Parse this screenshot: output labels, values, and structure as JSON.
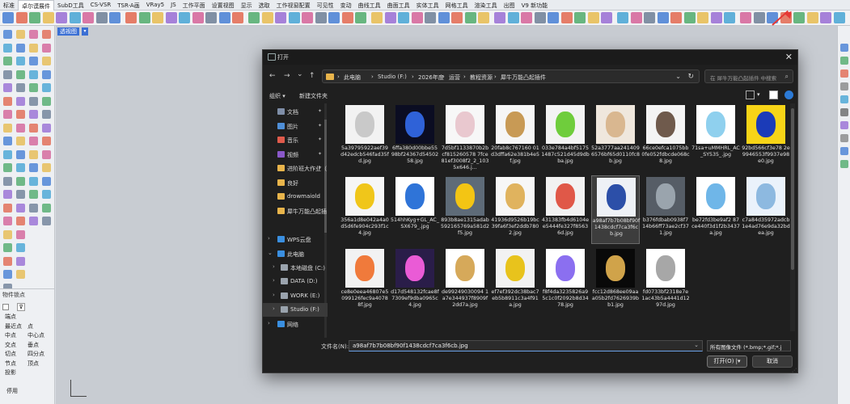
{
  "menu_tabs": [
    "标准",
    "卓尔谟展件",
    "SubD工具",
    "CS-VSR",
    "TSR-A画",
    "VRay5",
    "JS",
    "工作平面",
    "设置视图",
    "显示",
    "选取",
    "工作视窗配置",
    "可见性",
    "变动",
    "曲线工具",
    "曲面工具",
    "实体工具",
    "网格工具",
    "渲染工具",
    "出图",
    "V9 新功能"
  ],
  "active_tab_index": 1,
  "viewport": {
    "label": "透视图",
    "caret": "▾"
  },
  "osnap": {
    "title": "物件锁点",
    "funnel_icon": "filter-icon",
    "items": [
      "端点",
      "最近点",
      "点",
      "中点",
      "中心点",
      "交点",
      "垂点",
      "切点",
      "四分点",
      "节点",
      "顶点",
      "投影",
      "停用"
    ]
  },
  "dialog": {
    "title": "打开",
    "title_icon": "rhino-icon",
    "close": "✕",
    "nav": {
      "back": "←",
      "forward": "→",
      "down": "⌄",
      "up": "↑",
      "refresh": "↻",
      "dropdown": "⌄"
    },
    "breadcrumbs": [
      "此电脑",
      "Studio (F:)",
      "2026年度",
      "运营",
      "教程资源",
      "犀牛万能凸起插件"
    ],
    "search_placeholder": "在 犀牛万能凸起插件 中搜索",
    "search_icon": "search-icon",
    "organize_label": "组织 ▾",
    "new_folder_label": "新建文件夹",
    "sidebar": [
      {
        "label": "文档",
        "pin": "✦",
        "icon": "documents-icon",
        "color": "#7f8ea8"
      },
      {
        "label": "图片",
        "pin": "✦",
        "icon": "pictures-icon",
        "color": "#4f8fd8"
      },
      {
        "label": "音乐",
        "pin": "✦",
        "icon": "music-icon",
        "color": "#e05b4c"
      },
      {
        "label": "视频",
        "pin": "✦",
        "icon": "video-icon",
        "color": "#8a58c9"
      },
      {
        "label": "进阶班大作业（",
        "pin": "✦",
        "icon": "folder-icon",
        "color": "#e8b44b"
      },
      {
        "label": "良好",
        "pin": "",
        "icon": "folder-icon",
        "color": "#e8b44b"
      },
      {
        "label": "drowmaiold",
        "pin": "",
        "icon": "folder-icon",
        "color": "#e8b44b"
      },
      {
        "label": "犀牛万能凸起插",
        "pin": "",
        "icon": "folder-icon",
        "color": "#e8b44b"
      },
      {
        "label": "WPS云盘",
        "pin": "",
        "icon": "cloud-icon",
        "color": "#3a8fe0",
        "chev": "›"
      },
      {
        "label": "此电脑",
        "pin": "",
        "icon": "computer-icon",
        "color": "#3a8fe0",
        "chev": "⌄"
      },
      {
        "label": "本地磁盘 (C:)",
        "pin": "",
        "icon": "drive-icon",
        "color": "#9aa3ad",
        "chev": "›"
      },
      {
        "label": "DATA (D:)",
        "pin": "",
        "icon": "drive-icon",
        "color": "#9aa3ad",
        "chev": "›"
      },
      {
        "label": "WORK (E:)",
        "pin": "",
        "icon": "drive-icon",
        "color": "#9aa3ad",
        "chev": "›"
      },
      {
        "label": "Studio (F:)",
        "pin": "",
        "icon": "drive-icon",
        "color": "#9aa3ad",
        "chev": "›",
        "selected": true
      },
      {
        "label": "网络",
        "pin": "",
        "icon": "network-icon",
        "color": "#3a8fe0",
        "chev": "›"
      }
    ],
    "files": [
      {
        "caption": "5a39795922aef39d42edcb546fad35fd.jpg",
        "thumb": "#f2f2f2",
        "shape": "#c9c9c9"
      },
      {
        "caption": "6ffa380d00bbe5598bf24367d5450258.jpg",
        "thumb": "#0b0d22",
        "shape": "#2f62d8"
      },
      {
        "caption": "7d5bf1133870b2bcf815260578 7fce81ef3008f2_2_1035x646.j...",
        "thumb": "#f7f7f7",
        "shape": "#e9c8cf"
      },
      {
        "caption": "20fab8c767160 01d3dffa62e381b4e5f.jpg",
        "thumb": "#f6f6f6",
        "shape": "#c89a55"
      },
      {
        "caption": "033e784a4bf51751487c521d45d9dbba.jpg",
        "thumb": "#f3f3f3",
        "shape": "#6fcd3c"
      },
      {
        "caption": "52a3777aa2414096576bf65d0110fc8b.jpg",
        "thumb": "#efe7dd",
        "shape": "#d9b790"
      },
      {
        "caption": "66ce0efca1075bb0fe052fdbcde068c8.jpg",
        "thumb": "#f4f4f4",
        "shape": "#6f5a4c"
      },
      {
        "caption": "71sa+uMMHRL_AC_SY535_.jpg",
        "thumb": "#ffffff",
        "shape": "#8fd0ee"
      },
      {
        "caption": "92bd566cf3e78 2e9946553f9937e98e0.jpg",
        "thumb": "#f7d417",
        "shape": "#1b3bb8"
      },
      {
        "caption": "356a1d8e042a4a0d5d6fe904c293f1c4.jpg",
        "thumb": "#f6f6f6",
        "shape": "#f0c61a"
      },
      {
        "caption": "514hhKyg+GL_AC_SX679_.jpg",
        "thumb": "#ffffff",
        "shape": "#2f74d8"
      },
      {
        "caption": "893b8ae1315adab592165769a581d2f5.jpg",
        "thumb": "#5e6b78",
        "shape": "#f3c514"
      },
      {
        "caption": "41936d9526b19bc39fa6f3ef2ddb7802.jpg",
        "thumb": "#f7f7f7",
        "shape": "#e0b35e"
      },
      {
        "caption": "431383fb4d6104ee5444fe327f85636d.jpg",
        "thumb": "#f2f2f2",
        "shape": "#e05848"
      },
      {
        "caption": "a98af7b7b08bf90f1438cdcf7ca3f6cb.jpg",
        "thumb": "#eef1f6",
        "shape": "#2c4fa8",
        "selected": true
      },
      {
        "caption": "b376fdbab0938f714b66ff73ae2cf371.jpg",
        "thumb": "#565d66",
        "shape": "#9aa4ad"
      },
      {
        "caption": "be72fd3be9af2 87ce440f3d1f2b3437a.jpg",
        "thumb": "#ffffff",
        "shape": "#6fb6e8"
      },
      {
        "caption": "c7a84d35972adcb1e4ad76e9da32bdea.jpg",
        "thumb": "#eaf2fb",
        "shape": "#8db9e0"
      },
      {
        "caption": "ce8e0eea46807e5099126fec9a40788f.jpg",
        "thumb": "#f2f2f2",
        "shape": "#f07a3b"
      },
      {
        "caption": "d17d548132fcae8f7309ef9dba0965c4.jpg",
        "thumb": "#2a1d49",
        "shape": "#ea5bd6"
      },
      {
        "caption": "de99249030094 1a7e344937f8909f2dd7a.jpg",
        "thumb": "#ffffff",
        "shape": "#d6a95a"
      },
      {
        "caption": "ef7ef392dc38bac7eb5b8911c3a4f91a.jpg",
        "thumb": "#f2f2f2",
        "shape": "#e8c31c"
      },
      {
        "caption": "f8f4da3235826a95c1c0f2092b8d3478.jpg",
        "thumb": "#ffffff",
        "shape": "#8b6ff0"
      },
      {
        "caption": "fcc12d868ee09aaa05b2fd7626939bb1.jpg",
        "thumb": "#090909",
        "shape": "#d0a34a"
      },
      {
        "caption": "fd0733bf2318e7e1ac43b5a4441d1297d.jpg",
        "thumb": "#ffffff",
        "shape": "#a7a7a7"
      }
    ],
    "filename_label": "文件名(N):",
    "filename_value": "a98af7b7b08bf90f1438cdcf7ca3f6cb.jpg",
    "filetype_value": "所有图像文件 (*.bmp;*.gif;*.j",
    "open_label": "打开(O)",
    "open_dd": "|▾",
    "cancel_label": "取消"
  },
  "toolbar_colors": [
    "#2f6fd0",
    "#e0563a",
    "#3aa15a",
    "#e6b43a",
    "#8c5bd0",
    "#2f9ad0",
    "#d04f8c",
    "#5b6f8a"
  ],
  "accent": "#e53935"
}
